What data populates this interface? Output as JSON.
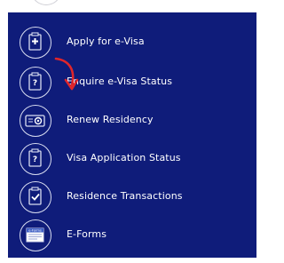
{
  "menu": {
    "items": [
      {
        "label": "Apply for e-Visa",
        "icon": "document-plus-icon"
      },
      {
        "label": "Enquire e-Visa Status",
        "icon": "document-question-icon"
      },
      {
        "label": "Renew Residency",
        "icon": "card-renew-icon"
      },
      {
        "label": "Visa Application Status",
        "icon": "document-question-icon"
      },
      {
        "label": "Residence Transactions",
        "icon": "document-check-icon"
      },
      {
        "label": "E-Forms",
        "icon": "forms-icon",
        "icon_text": "e-Forms"
      }
    ]
  },
  "colors": {
    "panel_background": "#0f1c7a",
    "icon_stroke": "#d8dcf0",
    "label_text": "#ffffff",
    "annotation_arrow": "#e0262b"
  }
}
